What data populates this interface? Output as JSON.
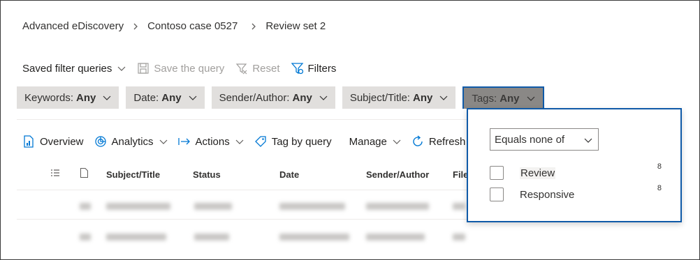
{
  "breadcrumb": {
    "items": [
      "Advanced eDiscovery",
      "Contoso case 0527",
      "Review set 2"
    ],
    "separator_icon": "chevron-right-icon"
  },
  "query_bar": {
    "saved_filter_queries": "Saved filter queries",
    "save_query": "Save the query",
    "reset": "Reset",
    "filters": "Filters"
  },
  "filters": [
    {
      "label": "Keywords:",
      "value": "Any"
    },
    {
      "label": "Date:",
      "value": "Any"
    },
    {
      "label": "Sender/Author:",
      "value": "Any"
    },
    {
      "label": "Subject/Title:",
      "value": "Any"
    },
    {
      "label": "Tags:",
      "value": "Any"
    }
  ],
  "actions": {
    "overview": "Overview",
    "analytics": "Analytics",
    "actions": "Actions",
    "tag_by_query": "Tag by query",
    "manage": "Manage",
    "refresh": "Refresh"
  },
  "table": {
    "columns": [
      "Subject/Title",
      "Status",
      "Date",
      "Sender/Author",
      "File"
    ]
  },
  "tags_panel": {
    "operator": "Equals none of",
    "options": [
      {
        "label": "Review",
        "count": "8"
      },
      {
        "label": "Responsive",
        "count": "8"
      }
    ]
  },
  "colors": {
    "accent": "#0f5aa8",
    "pill_bg": "#e1dfdd",
    "active_pill_bg": "#8a8886",
    "icon_blue": "#0078d4"
  }
}
